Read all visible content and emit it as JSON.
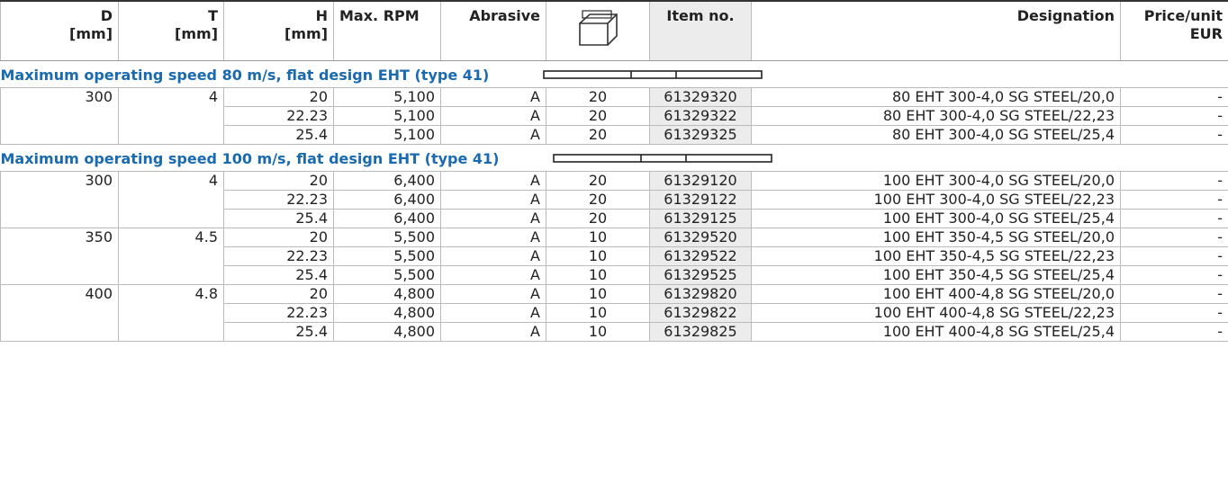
{
  "header": {
    "d": [
      "D",
      "[mm]"
    ],
    "t": [
      "T",
      "[mm]"
    ],
    "h": [
      "H",
      "[mm]"
    ],
    "rpm": "Max. RPM",
    "abrasive": "Abrasive",
    "item": "Item no.",
    "designation": "Designation",
    "price": [
      "Price/unit",
      "EUR"
    ]
  },
  "sections": [
    {
      "title": "Maximum operating speed 80 m/s, flat design EHT (type 41)",
      "groups": [
        {
          "d": "300",
          "t": "4",
          "rows": [
            {
              "h": "20",
              "rpm": "5,100",
              "abr": "A",
              "pack": "20",
              "item": "61329320",
              "des": "80 EHT 300-4,0 SG STEEL/20,0",
              "price": "-"
            },
            {
              "h": "22.23",
              "rpm": "5,100",
              "abr": "A",
              "pack": "20",
              "item": "61329322",
              "des": "80 EHT 300-4,0 SG STEEL/22,23",
              "price": "-"
            },
            {
              "h": "25.4",
              "rpm": "5,100",
              "abr": "A",
              "pack": "20",
              "item": "61329325",
              "des": "80 EHT 300-4,0 SG STEEL/25,4",
              "price": "-"
            }
          ]
        }
      ]
    },
    {
      "title": "Maximum operating speed 100 m/s, flat design EHT (type 41)",
      "groups": [
        {
          "d": "300",
          "t": "4",
          "rows": [
            {
              "h": "20",
              "rpm": "6,400",
              "abr": "A",
              "pack": "20",
              "item": "61329120",
              "des": "100 EHT 300-4,0 SG STEEL/20,0",
              "price": "-"
            },
            {
              "h": "22.23",
              "rpm": "6,400",
              "abr": "A",
              "pack": "20",
              "item": "61329122",
              "des": "100 EHT 300-4,0 SG STEEL/22,23",
              "price": "-"
            },
            {
              "h": "25.4",
              "rpm": "6,400",
              "abr": "A",
              "pack": "20",
              "item": "61329125",
              "des": "100 EHT 300-4,0 SG STEEL/25,4",
              "price": "-"
            }
          ]
        },
        {
          "d": "350",
          "t": "4.5",
          "rows": [
            {
              "h": "20",
              "rpm": "5,500",
              "abr": "A",
              "pack": "10",
              "item": "61329520",
              "des": "100 EHT 350-4,5 SG STEEL/20,0",
              "price": "-"
            },
            {
              "h": "22.23",
              "rpm": "5,500",
              "abr": "A",
              "pack": "10",
              "item": "61329522",
              "des": "100 EHT 350-4,5 SG STEEL/22,23",
              "price": "-"
            },
            {
              "h": "25.4",
              "rpm": "5,500",
              "abr": "A",
              "pack": "10",
              "item": "61329525",
              "des": "100 EHT 350-4,5 SG STEEL/25,4",
              "price": "-"
            }
          ]
        },
        {
          "d": "400",
          "t": "4.8",
          "rows": [
            {
              "h": "20",
              "rpm": "4,800",
              "abr": "A",
              "pack": "10",
              "item": "61329820",
              "des": "100 EHT 400-4,8 SG STEEL/20,0",
              "price": "-"
            },
            {
              "h": "22.23",
              "rpm": "4,800",
              "abr": "A",
              "pack": "10",
              "item": "61329822",
              "des": "100 EHT 400-4,8 SG STEEL/22,23",
              "price": "-"
            },
            {
              "h": "25.4",
              "rpm": "4,800",
              "abr": "A",
              "pack": "10",
              "item": "61329825",
              "des": "100 EHT 400-4,8 SG STEEL/25,4",
              "price": "-"
            }
          ]
        }
      ]
    }
  ]
}
